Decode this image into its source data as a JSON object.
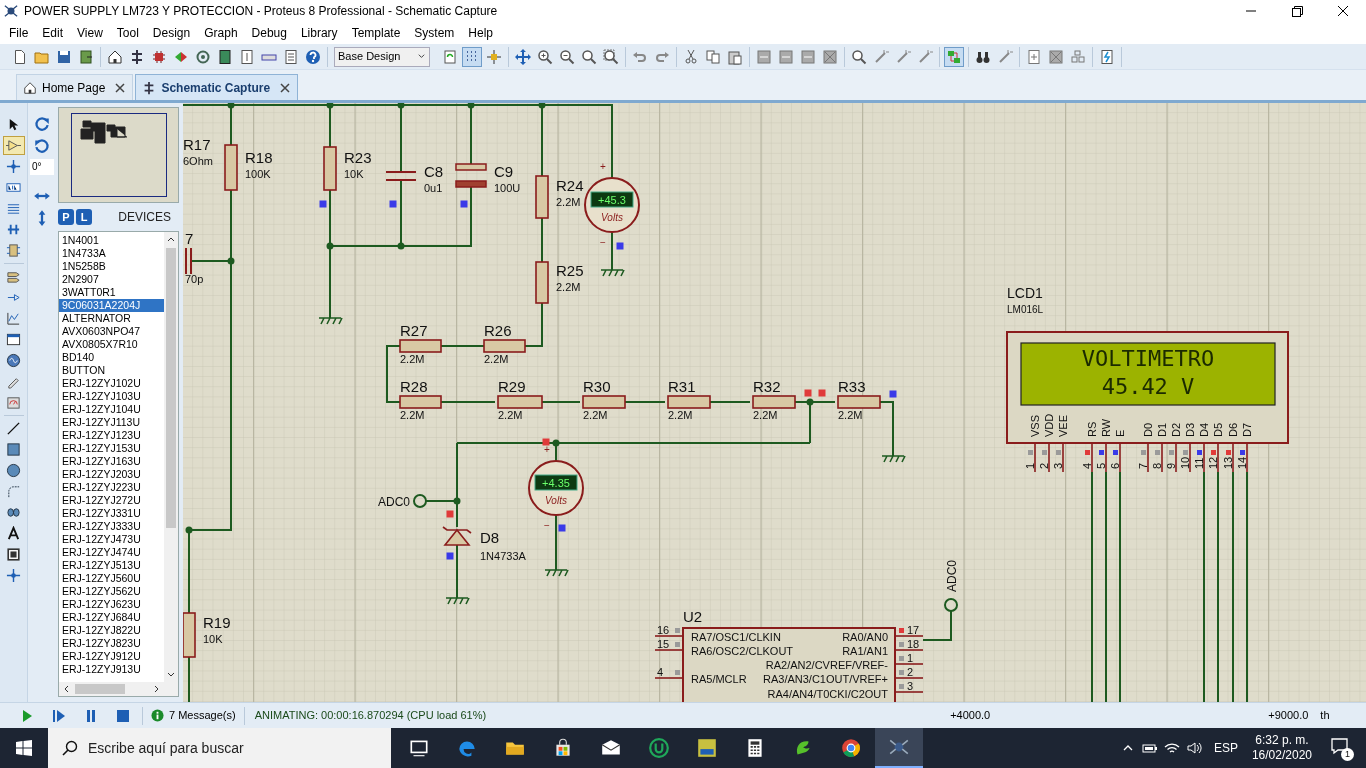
{
  "window": {
    "title": "POWER SUPPLY LM723 Y PROTECCION - Proteus 8 Professional - Schematic Capture"
  },
  "menu": [
    "File",
    "Edit",
    "View",
    "Tool",
    "Design",
    "Graph",
    "Debug",
    "Library",
    "Template",
    "System",
    "Help"
  ],
  "toolbar": {
    "design_select": "Base Design",
    "groups": [
      [
        {
          "kind": "new",
          "on": false
        },
        {
          "kind": "open",
          "on": false
        },
        {
          "kind": "save",
          "on": false
        },
        {
          "kind": "import",
          "on": false
        }
      ],
      [
        {
          "kind": "home",
          "on": false
        },
        {
          "kind": "schematic",
          "on": false
        },
        {
          "kind": "pcb",
          "on": false
        },
        {
          "kind": "gerber",
          "on": false
        },
        {
          "kind": "ring",
          "on": false
        },
        {
          "kind": "bom",
          "on": false
        },
        {
          "kind": "cost",
          "on": false
        },
        {
          "kind": "bar",
          "on": false
        },
        {
          "kind": "notes",
          "on": false
        },
        {
          "kind": "help",
          "on": false
        }
      ],
      [
        {
          "kind": "refresh",
          "on": false
        },
        {
          "kind": "grid",
          "on": true
        },
        {
          "kind": "origin",
          "on": false
        }
      ],
      [
        {
          "kind": "move",
          "on": false
        },
        {
          "kind": "zoom_in",
          "on": false
        },
        {
          "kind": "zoom_out",
          "on": false
        },
        {
          "kind": "zoom_all",
          "on": false
        },
        {
          "kind": "zoom_area",
          "on": false
        }
      ],
      [
        {
          "kind": "undo",
          "on": false
        },
        {
          "kind": "redo",
          "on": false
        }
      ],
      [
        {
          "kind": "cut",
          "on": false
        },
        {
          "kind": "copy",
          "on": false
        },
        {
          "kind": "paste",
          "on": false
        }
      ],
      [
        {
          "kind": "block",
          "on": false
        },
        {
          "kind": "block",
          "on": false
        },
        {
          "kind": "block",
          "on": false
        },
        {
          "kind": "block_x",
          "on": false
        }
      ],
      [
        {
          "kind": "magnifier",
          "on": false
        },
        {
          "kind": "wand",
          "on": false
        },
        {
          "kind": "wand",
          "on": false
        },
        {
          "kind": "wand",
          "on": false
        }
      ],
      [
        {
          "kind": "explorer",
          "on": true
        }
      ],
      [
        {
          "kind": "binoculars",
          "on": false
        },
        {
          "kind": "wand",
          "on": false
        }
      ],
      [
        {
          "kind": "new_sheet",
          "on": false
        },
        {
          "kind": "block_x",
          "on": false
        },
        {
          "kind": "tree",
          "on": false
        }
      ],
      [
        {
          "kind": "netlist",
          "on": false
        }
      ]
    ]
  },
  "tabs": [
    {
      "label": "Home Page",
      "kind": "home",
      "selected": false
    },
    {
      "label": "Schematic Capture",
      "kind": "schematic",
      "selected": true
    }
  ],
  "mode_tools": [
    {
      "kind": "arrow",
      "selected": false
    },
    {
      "kind": "component",
      "selected": true
    },
    {
      "kind": "junction",
      "selected": false
    },
    {
      "kind": "label",
      "selected": false
    },
    {
      "kind": "lines",
      "selected": false
    },
    {
      "kind": "bus",
      "selected": false
    },
    {
      "kind": "subcircuit",
      "selected": false
    },
    {
      "kind": "terminal",
      "selected": false
    },
    {
      "kind": "pin",
      "selected": false
    },
    {
      "kind": "graph",
      "selected": false
    },
    {
      "kind": "window",
      "selected": false
    },
    {
      "kind": "generator",
      "selected": false
    },
    {
      "kind": "probe",
      "selected": false
    },
    {
      "kind": "instrument",
      "selected": false
    },
    {
      "kind": "line",
      "selected": false
    },
    {
      "kind": "box",
      "selected": false
    },
    {
      "kind": "circle",
      "selected": false
    },
    {
      "kind": "arc",
      "selected": false
    },
    {
      "kind": "path",
      "selected": false
    },
    {
      "kind": "text",
      "selected": false
    },
    {
      "kind": "symbol",
      "selected": false
    },
    {
      "kind": "junction",
      "selected": false
    }
  ],
  "orientation": {
    "angle": "0°"
  },
  "devices": {
    "pick_button": "P",
    "library_button": "L",
    "title": "DEVICES",
    "items": [
      {
        "label": "1N4001",
        "selected": false
      },
      {
        "label": "1N4733A",
        "selected": false
      },
      {
        "label": "1N5258B",
        "selected": false
      },
      {
        "label": "2N2907",
        "selected": false
      },
      {
        "label": "3WATT0R1",
        "selected": false
      },
      {
        "label": "9C06031A2204J",
        "selected": true
      },
      {
        "label": "ALTERNATOR",
        "selected": false
      },
      {
        "label": "AVX0603NPO47",
        "selected": false
      },
      {
        "label": "AVX0805X7R10",
        "selected": false
      },
      {
        "label": "BD140",
        "selected": false
      },
      {
        "label": "BUTTON",
        "selected": false
      },
      {
        "label": "ERJ-12ZYJ102U",
        "selected": false
      },
      {
        "label": "ERJ-12ZYJ103U",
        "selected": false
      },
      {
        "label": "ERJ-12ZYJ104U",
        "selected": false
      },
      {
        "label": "ERJ-12ZYJ113U",
        "selected": false
      },
      {
        "label": "ERJ-12ZYJ123U",
        "selected": false
      },
      {
        "label": "ERJ-12ZYJ153U",
        "selected": false
      },
      {
        "label": "ERJ-12ZYJ163U",
        "selected": false
      },
      {
        "label": "ERJ-12ZYJ203U",
        "selected": false
      },
      {
        "label": "ERJ-12ZYJ223U",
        "selected": false
      },
      {
        "label": "ERJ-12ZYJ272U",
        "selected": false
      },
      {
        "label": "ERJ-12ZYJ331U",
        "selected": false
      },
      {
        "label": "ERJ-12ZYJ333U",
        "selected": false
      },
      {
        "label": "ERJ-12ZYJ473U",
        "selected": false
      },
      {
        "label": "ERJ-12ZYJ474U",
        "selected": false
      },
      {
        "label": "ERJ-12ZYJ513U",
        "selected": false
      },
      {
        "label": "ERJ-12ZYJ560U",
        "selected": false
      },
      {
        "label": "ERJ-12ZYJ562U",
        "selected": false
      },
      {
        "label": "ERJ-12ZYJ623U",
        "selected": false
      },
      {
        "label": "ERJ-12ZYJ684U",
        "selected": false
      },
      {
        "label": "ERJ-12ZYJ822U",
        "selected": false
      },
      {
        "label": "ERJ-12ZYJ823U",
        "selected": false
      },
      {
        "label": "ERJ-12ZYJ912U",
        "selected": false
      },
      {
        "label": "ERJ-12ZYJ913U",
        "selected": false
      }
    ]
  },
  "schematic": {
    "resistors": [
      {
        "ref": "R17",
        "value": "6Ohm"
      },
      {
        "ref": "R18",
        "value": "100K"
      },
      {
        "ref": "R19",
        "value": "10K"
      },
      {
        "ref": "R23",
        "value": "10K"
      },
      {
        "ref": "R24",
        "value": "2.2M"
      },
      {
        "ref": "R25",
        "value": "2.2M"
      },
      {
        "ref": "R27",
        "value": "2.2M"
      },
      {
        "ref": "R26",
        "value": "2.2M"
      },
      {
        "ref": "R28",
        "value": "2.2M"
      },
      {
        "ref": "R29",
        "value": "2.2M"
      },
      {
        "ref": "R30",
        "value": "2.2M"
      },
      {
        "ref": "R31",
        "value": "2.2M"
      },
      {
        "ref": "R32",
        "value": "2.2M"
      },
      {
        "ref": "R33",
        "value": "2.2M"
      }
    ],
    "capacitors": [
      {
        "ref": "7",
        "value": "70p",
        "kind": "vertical"
      },
      {
        "ref": "C8",
        "value": "0u1",
        "kind": "plain"
      },
      {
        "ref": "C9",
        "value": "100U",
        "kind": "electrolytic"
      }
    ],
    "diode": {
      "ref": "D8",
      "value": "1N4733A"
    },
    "voltmeters": [
      {
        "reading": "+45.3",
        "unit": "Volts",
        "plus": "+",
        "minus": "−"
      },
      {
        "reading": "+4.35",
        "unit": "Volts",
        "plus": "+",
        "minus": "−"
      }
    ],
    "terminals": [
      {
        "label": "ADC0"
      },
      {
        "label": "ADC0"
      }
    ],
    "probes": [
      {
        "color": "#3a3ae8"
      },
      {
        "color": "#3a3ae8"
      },
      {
        "color": "#3a3ae8"
      },
      {
        "color": "#3a3ae8"
      },
      {
        "color": "#e03a3a"
      },
      {
        "color": "#e03a3a"
      },
      {
        "color": "#3a3ae8"
      },
      {
        "color": "#e03a3a"
      },
      {
        "color": "#3a3ae8"
      },
      {
        "color": "#e03a3a"
      },
      {
        "color": "#3a3ae8"
      }
    ],
    "lcd": {
      "ref": "LCD1",
      "part": "LM016L",
      "lines": [
        "VOLTIMETRO",
        "45.42 V"
      ],
      "pins": [
        {
          "name": "VSS",
          "number": "1",
          "color": "#9a9a9a"
        },
        {
          "name": "VDD",
          "number": "2",
          "color": "#9a9a9a"
        },
        {
          "name": "VEE",
          "number": "3",
          "color": "#9a9a9a"
        },
        {
          "name": "RS",
          "number": "4",
          "color": "#e03a3a"
        },
        {
          "name": "RW",
          "number": "5",
          "color": "#3a3ae8"
        },
        {
          "name": "E",
          "number": "6",
          "color": "#3a3ae8"
        },
        {
          "name": "D0",
          "number": "7",
          "color": "#9a9a9a"
        },
        {
          "name": "D1",
          "number": "8",
          "color": "#9a9a9a"
        },
        {
          "name": "D2",
          "number": "9",
          "color": "#9a9a9a"
        },
        {
          "name": "D3",
          "number": "10",
          "color": "#9a9a9a"
        },
        {
          "name": "D4",
          "number": "11",
          "color": "#3a3ae8"
        },
        {
          "name": "D5",
          "number": "12",
          "color": "#e03a3a"
        },
        {
          "name": "D6",
          "number": "13",
          "color": "#e03a3a"
        },
        {
          "name": "D7",
          "number": "14",
          "color": "#3a3ae8"
        }
      ]
    },
    "chip": {
      "ref": "U2",
      "left_pins": [
        {
          "name": "RA7/OSC1/CLKIN",
          "number": "16",
          "color": "#9a9a9a"
        },
        {
          "name": "RA6/OSC2/CLKOUT",
          "number": "15",
          "color": "#9a9a9a"
        },
        {
          "name": "RA5/MCLR",
          "number": "4",
          "color": "#9a9a9a"
        }
      ],
      "right_pins": [
        {
          "name": "RA0/AN0",
          "number": "17",
          "color": "#e03a3a"
        },
        {
          "name": "RA1/AN1",
          "number": "18",
          "color": "#9a9a9a"
        },
        {
          "name": "RA2/AN2/CVREF/VREF-",
          "number": "1",
          "color": "#9a9a9a"
        },
        {
          "name": "RA3/AN3/C1OUT/VREF+",
          "number": "2",
          "color": "#9a9a9a"
        },
        {
          "name": "RA4/AN4/T0CKI/C2OUT",
          "number": "3",
          "color": "#9a9a9a"
        }
      ]
    }
  },
  "status_bar": {
    "messages": "7 Message(s)",
    "state": "ANIMATING: 00:00:16.870294 (CPU load 61%)",
    "x_coord": "+4000.0",
    "y_coord": "+9000.0",
    "unit": "th"
  },
  "taskbar": {
    "search_placeholder": "Escribe aquí para buscar",
    "apps": [
      {
        "kind": "taskview",
        "active": false
      },
      {
        "kind": "edge",
        "active": false
      },
      {
        "kind": "explorer",
        "active": false
      },
      {
        "kind": "store",
        "active": false
      },
      {
        "kind": "mail",
        "active": false
      },
      {
        "kind": "u_app",
        "active": false
      },
      {
        "kind": "avr_app",
        "active": false
      },
      {
        "kind": "calculator",
        "active": false
      },
      {
        "kind": "c_app",
        "active": false
      },
      {
        "kind": "chrome",
        "active": false
      },
      {
        "kind": "proteus",
        "active": true
      }
    ],
    "language": "ESP",
    "time": "6:32 p. m.",
    "date": "16/02/2020",
    "notifications": "1"
  }
}
